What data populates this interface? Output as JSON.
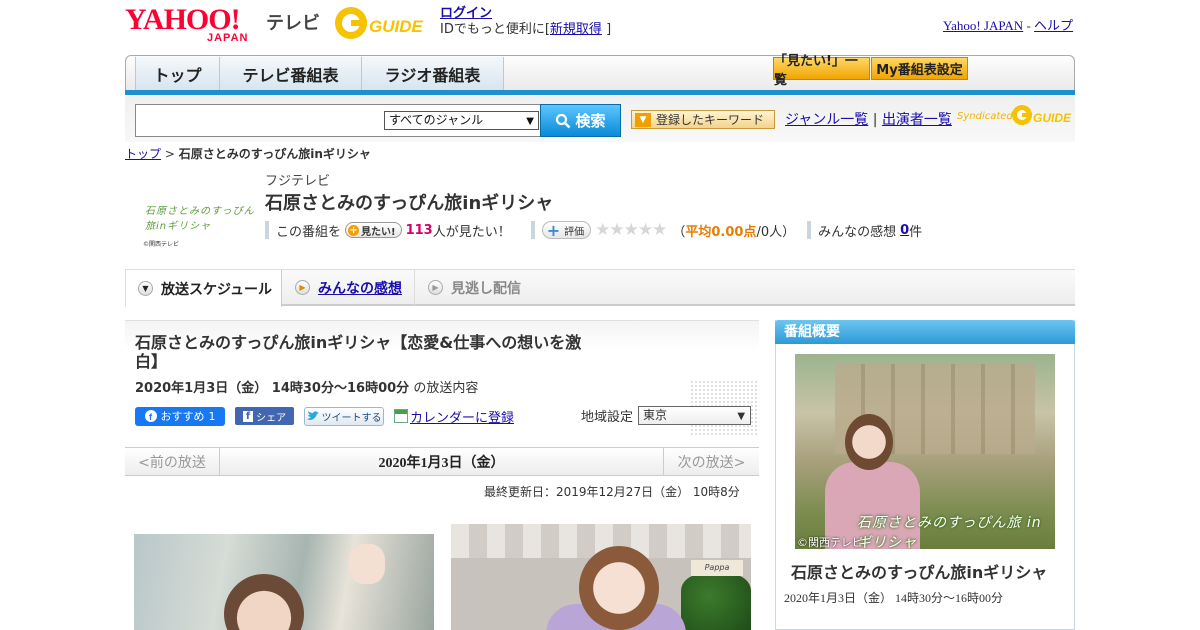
{
  "header": {
    "yahoo_logo": "YAHOO!",
    "yahoo_logo_sub": "JAPAN",
    "tv_label": "テレビ",
    "gguide_logo": "G-GUIDE",
    "login_label": "ログイン",
    "login_prompt_prefix": "IDでもっと便利に[",
    "signup_label": "新規取得",
    "login_prompt_suffix": "]",
    "yahoo_japan_link": "Yahoo! JAPAN",
    "link_separator": "-",
    "help_link": "ヘルプ"
  },
  "nav": {
    "tabs": [
      {
        "label": "トップ"
      },
      {
        "label": "テレビ番組表"
      },
      {
        "label": "ラジオ番組表"
      }
    ],
    "mitai_list_label": "「見たい!」一覧",
    "my_schedule_label": "My番組表設定"
  },
  "search": {
    "input_value": "",
    "genre_selected": "すべてのジャンル",
    "search_button_label": "検索",
    "keyword_button_label": "登録したキーワード",
    "genre_list_link": "ジャンル一覧",
    "link_separator": "|",
    "performer_list_link": "出演者一覧",
    "syndicated_label": "Syndicated"
  },
  "breadcrumb": {
    "top": "トップ",
    "separator": ">",
    "current": "石原さとみのすっぴん旅inギリシャ"
  },
  "program": {
    "thumb_text": "石原さとみのすっぴん旅inギリシャ",
    "thumb_copyright": "©関西テレビ",
    "channel": "フジテレビ",
    "title": "石原さとみのすっぴん旅inギリシャ",
    "this_program_label": "この番組を",
    "mitai_button": "見たい!",
    "mitai_count": "113",
    "mitai_suffix": "人が見たい！",
    "rate_button": "評価",
    "rating_open": "（",
    "rating_text": "平均0.00点",
    "rating_count": "/0人）",
    "impressions_label": "みんなの感想",
    "impressions_count": "0",
    "impressions_suffix": "件"
  },
  "program_tabs": {
    "schedule": "放送スケジュール",
    "impressions": "みんなの感想",
    "missed": "見逃し配信"
  },
  "episode": {
    "title": "石原さとみのすっぴん旅inギリシャ【恋愛&仕事への想いを激白】",
    "datetime": "2020年1月3日（金） 14時30分～16時00分",
    "datetime_suffix": "の放送内容",
    "fb_recommend": "おすすめ",
    "fb_recommend_count": "1",
    "fb_share": "シェア",
    "tweet": "ツイートする",
    "calendar_link": "カレンダーに登録",
    "region_label": "地域設定",
    "region_selected": "東京"
  },
  "pager": {
    "prev": "<前の放送",
    "date": "2020年1月3日（金）",
    "next": "次の放送>"
  },
  "updated": "最終更新日：2019年12月27日（金） 10時8分",
  "photos": {
    "sign_text": "Pappa"
  },
  "sidebar": {
    "header": "番組概要",
    "photo_caption": "石原さとみのすっぴん旅 in ギリシャ",
    "photo_copyright": "©関西テレビ",
    "title": "石原さとみのすっぴん旅inギリシャ",
    "time": "2020年1月3日（金） 14時30分～16時00分"
  }
}
